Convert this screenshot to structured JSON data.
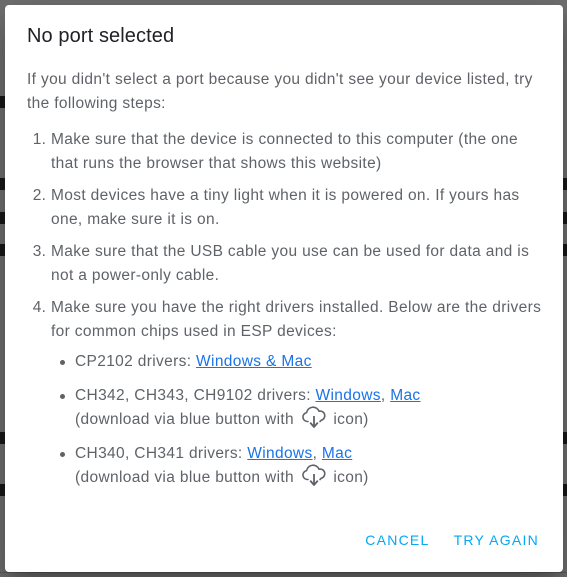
{
  "dialog": {
    "title": "No port selected",
    "intro": "If you didn't select a port because you didn't see your device listed, try the following steps:",
    "steps": [
      "Make sure that the device is connected to this computer (the one that runs the browser that shows this website)",
      "Most devices have a tiny light when it is powered on. If yours has one, make sure it is on.",
      "Make sure that the USB cable you use can be used for data and is not a power-only cable.",
      "Make sure you have the right drivers installed. Below are the drivers for common chips used in ESP devices:"
    ],
    "drivers": [
      {
        "label": "CP2102 drivers: ",
        "links": [
          "Windows & Mac"
        ]
      },
      {
        "label": "CH342, CH343, CH9102 drivers: ",
        "links": [
          "Windows",
          "Mac"
        ],
        "note_before": "(download via blue button with ",
        "note_after": " icon)"
      },
      {
        "label": "CH340, CH341 drivers: ",
        "links": [
          "Windows",
          "Mac"
        ],
        "note_before": "(download via blue button with ",
        "note_after": " icon)"
      }
    ],
    "separator": ", ",
    "cancel_label": "CANCEL",
    "try_again_label": "TRY AGAIN"
  },
  "colors": {
    "accent": "#03a9f4",
    "link": "#1a73e8",
    "text": "#5f6368",
    "title": "#202124"
  },
  "icons": {
    "download": "cloud-download-icon"
  }
}
